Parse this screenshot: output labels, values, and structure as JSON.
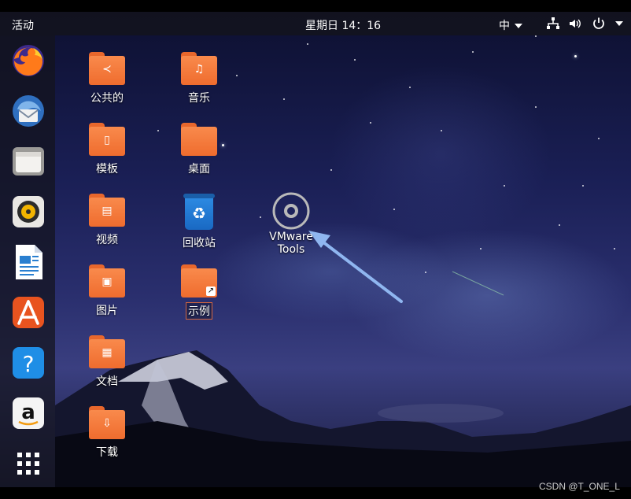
{
  "topbar": {
    "activities": "活动",
    "clock": "星期日 14：16",
    "input_method": "中",
    "icons": [
      "network-icon",
      "volume-icon",
      "power-icon"
    ]
  },
  "dock": {
    "apps": [
      "firefox-icon",
      "thunderbird-icon",
      "files-icon",
      "rhythmbox-icon",
      "libreoffice-writer-icon",
      "ubuntu-software-icon",
      "help-icon",
      "amazon-icon",
      "show-applications-icon"
    ]
  },
  "desktop": {
    "icons": [
      {
        "label": "公共的",
        "icon": "share-icon"
      },
      {
        "label": "音乐",
        "icon": "music-icon"
      },
      {
        "label": "模板",
        "icon": "template-icon"
      },
      {
        "label": "桌面",
        "icon": "folder-icon"
      },
      {
        "label": "视频",
        "icon": "video-icon"
      },
      {
        "label": "回收站",
        "icon": "trash-icon"
      },
      {
        "label": "图片",
        "icon": "picture-icon"
      },
      {
        "label": "示例",
        "icon": "link-icon"
      },
      {
        "label": "文档",
        "icon": "document-icon"
      },
      {
        "label": "下载",
        "icon": "download-icon"
      }
    ],
    "disc": {
      "label": "VMware Tools",
      "icon": "disc-icon"
    }
  },
  "watermark": "CSDN @T_ONE_L",
  "colors": {
    "folder": "#f47a3c",
    "accent": "#e95420",
    "arrow": "#8fb6f0"
  }
}
